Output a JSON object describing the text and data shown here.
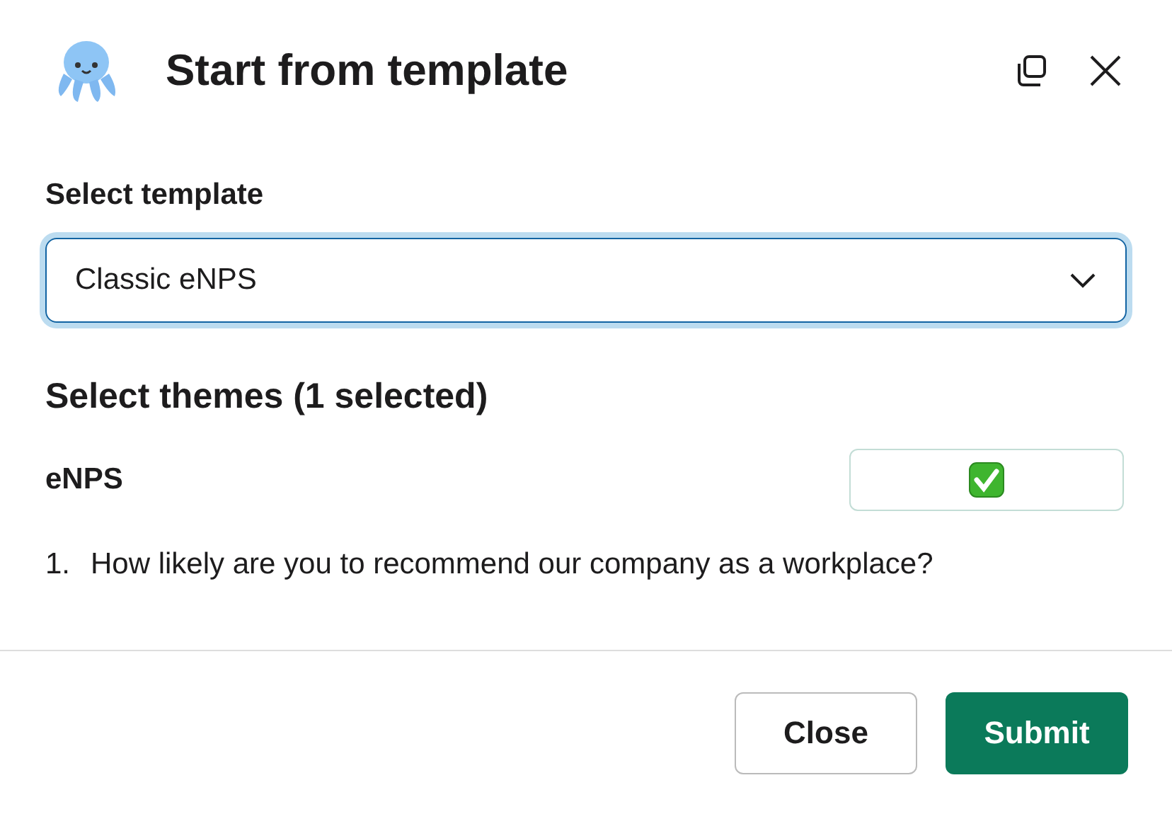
{
  "dialog": {
    "title": "Start from template"
  },
  "template": {
    "label": "Select template",
    "value": "Classic eNPS",
    "focused": true
  },
  "themes": {
    "heading": "Select themes (1 selected)",
    "items": [
      {
        "name": "eNPS",
        "checked": true,
        "questions": [
          {
            "number": "1.",
            "text": "How likely are you to recommend our company as a workplace?"
          }
        ]
      }
    ]
  },
  "buttons": [
    {
      "label": "Close",
      "kind": "secondary"
    },
    {
      "label": "Submit",
      "kind": "primary"
    }
  ]
}
